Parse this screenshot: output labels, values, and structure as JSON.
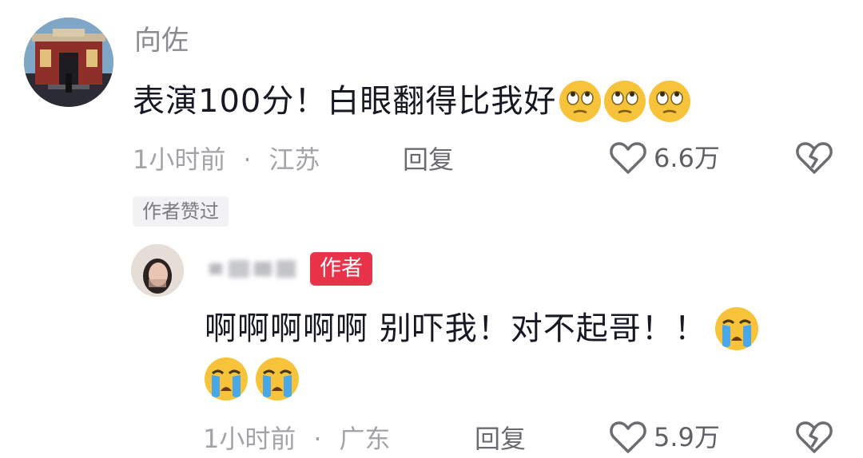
{
  "comments": [
    {
      "username": "向佐",
      "text": "表演100分！白眼翻得比我好",
      "emojis": [
        "eye-roll-emoji",
        "eye-roll-emoji",
        "eye-roll-emoji"
      ],
      "time": "1小时前",
      "separator": "·",
      "location": "江苏",
      "reply_label": "回复",
      "likes": "6.6万",
      "badge": "作者赞过"
    },
    {
      "username": "",
      "author_tag": "作者",
      "text_line1": "啊啊啊啊啊 别吓我！对不起哥！！",
      "emojis": [
        "crying-emoji",
        "crying-emoji",
        "crying-emoji"
      ],
      "time": "1小时前",
      "separator": "·",
      "location": "广东",
      "reply_label": "回复",
      "likes": "5.9万"
    }
  ],
  "colors": {
    "primary_text": "#161823",
    "secondary_text": "#a3a4a9",
    "author_badge": "#e8334a",
    "liked_badge_bg": "#f2f2f4"
  }
}
